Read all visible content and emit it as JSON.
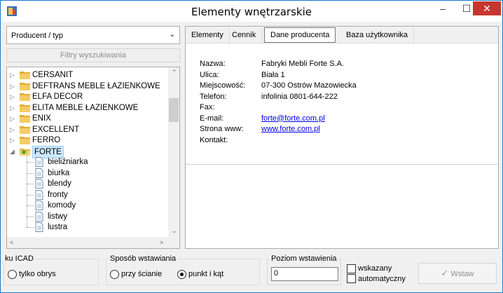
{
  "window": {
    "title": "Elementy wnętrzarskie",
    "minimize": "–",
    "maximize": "☐",
    "close": "✕"
  },
  "left": {
    "dropdown_value": "Producent / typ",
    "filter_button": "Filtry wyszukiwania",
    "tree": [
      {
        "label": "CERSANIT",
        "type": "folder",
        "expanded": false
      },
      {
        "label": "DEFTRANS MEBLE ŁAZIENKOWE",
        "type": "folder",
        "expanded": false
      },
      {
        "label": "ELFA DECOR",
        "type": "folder",
        "expanded": false
      },
      {
        "label": "ELITA MEBLE ŁAZIENKOWE",
        "type": "folder",
        "expanded": false
      },
      {
        "label": "ENIX",
        "type": "folder",
        "expanded": false
      },
      {
        "label": "EXCELLENT",
        "type": "folder",
        "expanded": false
      },
      {
        "label": "FERRO",
        "type": "folder",
        "expanded": false
      },
      {
        "label": "FORTE",
        "type": "folder",
        "expanded": true,
        "selected": true
      },
      {
        "label": "bieliźniarka",
        "type": "leaf"
      },
      {
        "label": "biurka",
        "type": "leaf"
      },
      {
        "label": "blendy",
        "type": "leaf"
      },
      {
        "label": "fronty",
        "type": "leaf"
      },
      {
        "label": "komody",
        "type": "leaf"
      },
      {
        "label": "listwy",
        "type": "leaf"
      },
      {
        "label": "lustra",
        "type": "leaf"
      }
    ]
  },
  "tabs": [
    {
      "label": "Elementy",
      "active": false
    },
    {
      "label": "Cennik",
      "active": false
    },
    {
      "label": "Dane producenta",
      "active": true
    },
    {
      "label": "Baza użytkownika",
      "active": false
    }
  ],
  "producer": {
    "fields": [
      {
        "label": "Nazwa:",
        "value": "Fabryki Mebli Forte S.A.",
        "link": false
      },
      {
        "label": "Ulica:",
        "value": "Biała 1",
        "link": false
      },
      {
        "label": "Miejscowość:",
        "value": "07-300 Ostrów Mazowiecka",
        "link": false
      },
      {
        "label": "Telefon:",
        "value": "infolinia 0801-644-222",
        "link": false
      },
      {
        "label": "Fax:",
        "value": "",
        "link": false
      },
      {
        "label": "E-mail:",
        "value": "forte@forte.com.pl",
        "link": true
      },
      {
        "label": "Strona www:",
        "value": "www.forte.com.pl",
        "link": true
      },
      {
        "label": "Kontakt:",
        "value": "",
        "link": false
      }
    ]
  },
  "bottom": {
    "icad_group": "ku ICAD",
    "icad_option": "tylko obrys",
    "insert_group": "Sposób wstawiania",
    "insert_wall": "przy ścianie",
    "insert_point": "punkt i kąt",
    "level_group": "Poziom wstawienia",
    "level_value": "0",
    "chk_indicated": "wskazany",
    "chk_auto": "automatyczny",
    "insert_button": "Wstaw"
  },
  "colors": {
    "accent": "#1979ca",
    "close": "#c7362e",
    "link": "#0000ee",
    "selection": "#cce8ff"
  }
}
